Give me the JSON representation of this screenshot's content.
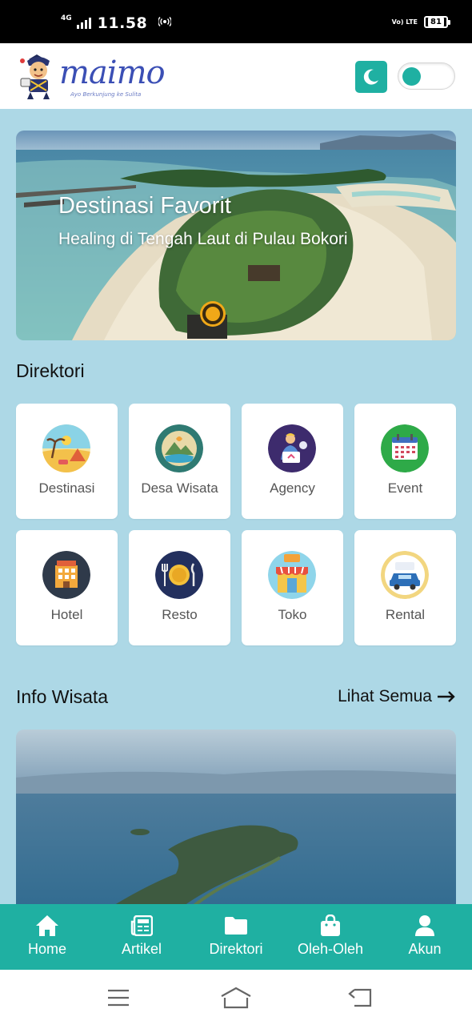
{
  "status_bar": {
    "network": "4G",
    "time": "11.58",
    "volte": "Vo) LTE",
    "battery": "81"
  },
  "header": {
    "logo_text": "maimo",
    "logo_tagline": "Ayo Berkunjung ke Sulita",
    "dark_mode_icon": "moon-icon",
    "toggle_state": "off"
  },
  "hero": {
    "title": "Destinasi Favorit",
    "subtitle": "Healing di Tengah Laut di Pulau Bokori"
  },
  "directory": {
    "title": "Direktori",
    "items": [
      {
        "label": "Destinasi",
        "icon": "beach-icon"
      },
      {
        "label": "Desa Wisata",
        "icon": "village-icon"
      },
      {
        "label": "Agency",
        "icon": "travel-agency-icon"
      },
      {
        "label": "Event",
        "icon": "calendar-icon"
      },
      {
        "label": "Hotel",
        "icon": "hotel-icon"
      },
      {
        "label": "Resto",
        "icon": "plate-cutlery-icon"
      },
      {
        "label": "Toko",
        "icon": "shop-icon"
      },
      {
        "label": "Rental",
        "icon": "rental-car-icon"
      }
    ]
  },
  "info": {
    "title": "Info Wisata",
    "see_all": "Lihat Semua"
  },
  "bottom_nav": {
    "items": [
      {
        "label": "Home",
        "icon": "home-icon"
      },
      {
        "label": "Artikel",
        "icon": "newspaper-icon"
      },
      {
        "label": "Direktori",
        "icon": "folder-icon"
      },
      {
        "label": "Oleh-Oleh",
        "icon": "shopping-bag-icon"
      },
      {
        "label": "Akun",
        "icon": "user-icon"
      }
    ]
  },
  "colors": {
    "primary": "#1fb0a2",
    "background": "#add8e6",
    "logo": "#3b4fb5"
  }
}
